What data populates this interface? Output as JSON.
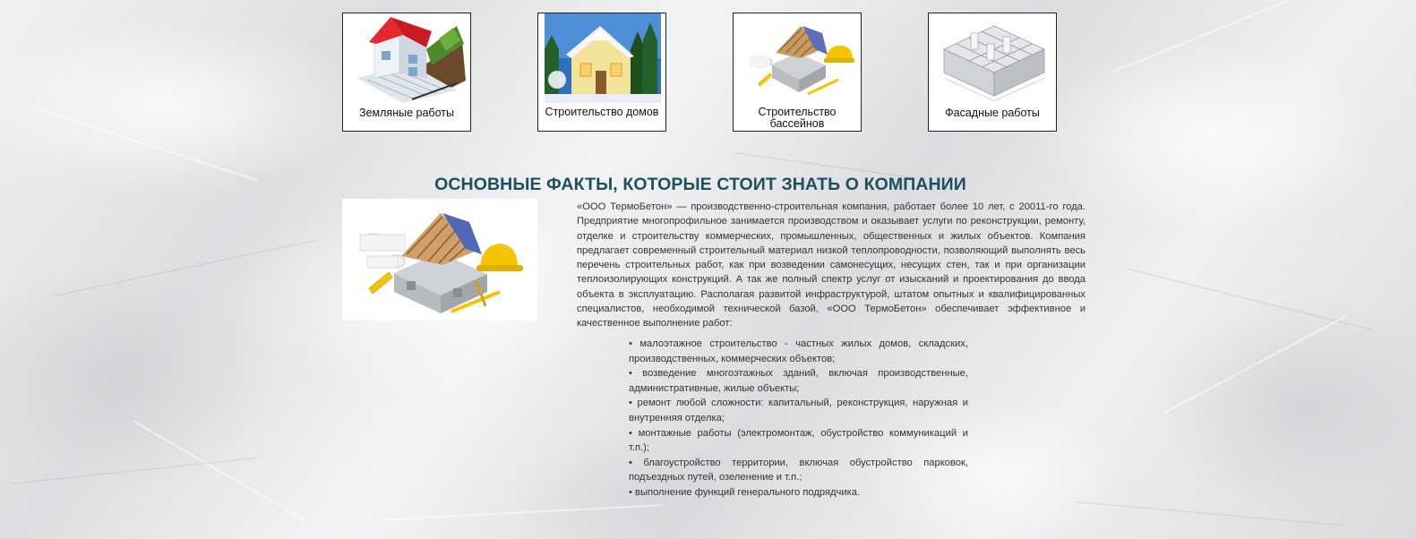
{
  "services": [
    {
      "label": "Земляные работы",
      "icon": "house-on-land-icon"
    },
    {
      "label": "Строительство домов",
      "icon": "house-building-icon"
    },
    {
      "label": "Строительство бассейнов",
      "icon": "house-construction-icon"
    },
    {
      "label": "Фасадные работы",
      "icon": "floor-plan-3d-icon"
    }
  ],
  "facts": {
    "title": "ОСНОВНЫЕ ФАКТЫ, КОТОРЫЕ СТОИТ ЗНАТЬ О КОМПАНИИ",
    "image_icon": "house-construction-icon",
    "paragraph": "«ООО ТермоБетон» — производственно-строительная компания, работает более 10 лет, с 20011-го года. Предприятие многопрофильное занимается производством и оказывает услуги по реконструкции, ремонту, отделке и строительству коммерческих, промышленных, общественных и жилых объектов. Компания предлагает современный строительный материал низкой теплопроводности, позволяющий выполнять весь перечень строительных работ, как при возведении самонесущих, несущих стен, так и при организации теплоизолирующих конструкций. А так же полный спектр услуг от изысканий и проектирования до ввода объекта в эксплуатацию. Располагая развитой инфраструктурой, штатом опытных и квалифицированных специалистов, необходимой технической базой, «ООО ТермоБетон» обеспечивает эффективное и качественное выполнение работ:",
    "list": [
      "малоэтажное строительство - частных жилых домов, складских, производственных, коммерческих объектов;",
      "возведение многоэтажных зданий, включая производственные, административные, жилые объекты;",
      "ремонт любой сложности: капитальный, реконструкция, наружная и внутренняя отделка;",
      "монтажные работы (электромонтаж, обустройство коммуникаций и т.п.);",
      "благоустройство территории, включая обустройство парковок, подъездных путей, озеленение и т.п.;",
      "выполнение функций генерального подрядчика."
    ]
  },
  "colors": {
    "title": "#1f4e5e",
    "text": "#333333",
    "card_border": "#222222",
    "roof_red": "#e8282f",
    "helmet_yellow": "#f5c400"
  }
}
